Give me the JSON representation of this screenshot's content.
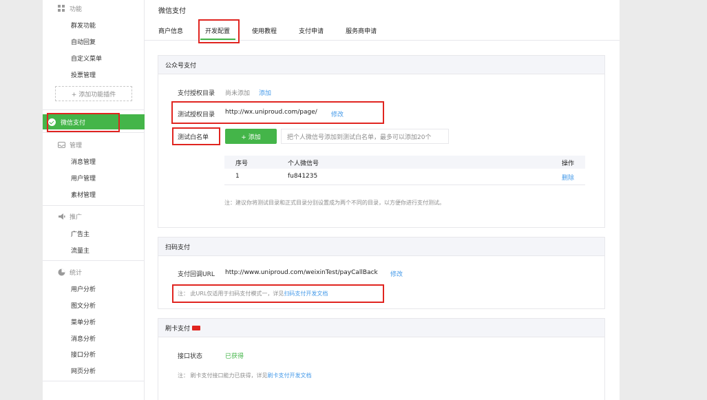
{
  "sidebar": {
    "function_head": "功能",
    "function_items": [
      "群发功能",
      "自动回复",
      "自定义菜单",
      "投票管理"
    ],
    "add_plugin": "+ 添加功能插件",
    "active_item": "微信支付",
    "manage_head": "管理",
    "manage_items": [
      "消息管理",
      "用户管理",
      "素材管理"
    ],
    "promo_head": "推广",
    "promo_items": [
      "广告主",
      "流量主"
    ],
    "stats_head": "统计",
    "stats_items": [
      "用户分析",
      "图文分析",
      "菜单分析",
      "消息分析",
      "接口分析",
      "网页分析"
    ]
  },
  "header": {
    "title": "微信支付",
    "tabs": [
      "商户信息",
      "开发配置",
      "使用教程",
      "支付申请",
      "服务商申请"
    ]
  },
  "panel_public": {
    "title": "公众号支付",
    "pay_dir_label": "支付授权目录",
    "pay_dir_value": "尚未添加",
    "pay_dir_add": "添加",
    "test_dir_label": "测试授权目录",
    "test_dir_value": "http://wx.uniproud.com/page/",
    "test_dir_edit": "修改",
    "whitelist_label": "测试白名单",
    "add_button": "+ 添加",
    "whitelist_placeholder": "把个人微信号添加到测试白名单，最多可以添加20个",
    "table_headers": [
      "序号",
      "个人微信号",
      "操作"
    ],
    "rows": [
      {
        "index": "1",
        "wechat": "fu841235",
        "action": "删除"
      }
    ],
    "note": "注：建议你将测试目录和正式目录分别设置成为两个不同的目录，以方便你进行支付测试。"
  },
  "panel_scan": {
    "title": "扫码支付",
    "callback_label": "支付回调URL",
    "callback_value": "http://www.uniproud.com/weixinTest/payCallBack",
    "callback_edit": "修改",
    "note_prefix": "注： 此URL仅适用于扫码支付模式一，详见",
    "note_link": "扫码支付开发文档"
  },
  "panel_card": {
    "title": "刷卡支付",
    "status_label": "接口状态",
    "status_value": "已获得",
    "note_prefix": "注： 刷卡支付接口能力已获得，详见",
    "note_link": "刷卡支付开发文档"
  },
  "colors": {
    "accent": "#44b549",
    "link": "#459ae9",
    "highlight": "#e0241f"
  }
}
